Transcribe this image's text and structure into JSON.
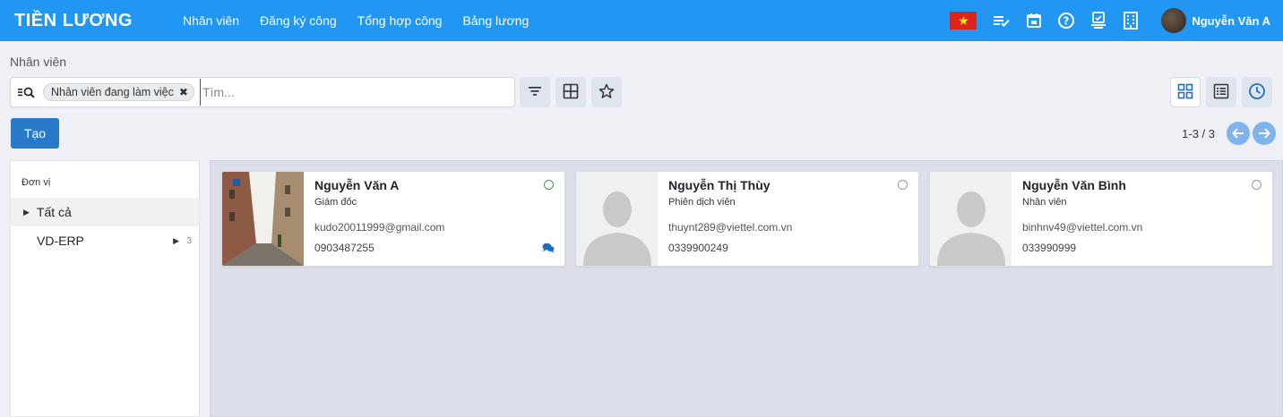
{
  "app": {
    "brand": "TIỀN LƯƠNG",
    "menu": [
      {
        "label": "Nhân viên"
      },
      {
        "label": "Đăng ký công"
      },
      {
        "label": "Tổng hợp công"
      },
      {
        "label": "Bảng lương"
      }
    ],
    "user_name": "Nguyễn Văn A",
    "accent_color": "#2196f3"
  },
  "breadcrumb": "Nhân viên",
  "search": {
    "facet": "Nhân viên đang làm việc",
    "placeholder": "Tìm..."
  },
  "create_label": "Tạo",
  "pager": {
    "value": "1-3 / 3"
  },
  "sidebar": {
    "header": "Đơn vị",
    "items": [
      {
        "label": "Tất cả",
        "active": true
      },
      {
        "label": "VD-ERP",
        "count": "3"
      }
    ]
  },
  "employees": [
    {
      "name": "Nguyễn Văn A",
      "job": "Giám đốc",
      "email": "kudo20011999@gmail.com",
      "phone": "0903487255",
      "status": "present",
      "has_photo": true,
      "has_messages": true
    },
    {
      "name": "Nguyễn Thị Thùy",
      "job": "Phiên dịch viên",
      "email": "thuynt289@viettel.com.vn",
      "phone": "0339900249",
      "status": "absent",
      "has_photo": false
    },
    {
      "name": "Nguyễn Văn Bình",
      "job": "Nhân viên",
      "email": "binhnv49@viettel.com.vn",
      "phone": "033990999",
      "status": "absent",
      "has_photo": false
    }
  ]
}
